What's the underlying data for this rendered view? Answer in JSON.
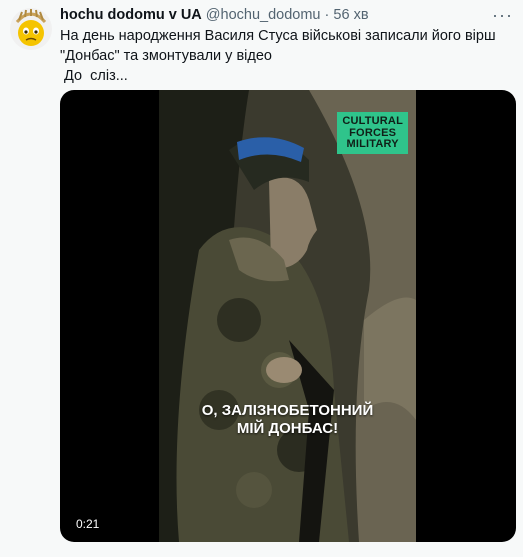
{
  "tweet": {
    "author_name": "hochu dodomu v UA",
    "handle": "@hochu_dodomu",
    "separator": "·",
    "time": "56 хв",
    "more": "···",
    "text_lines": [
      "На день народження Василя Стуса військові записали його вірш",
      "\"Донбас\" та змонтували у відео",
      " До  сліз..."
    ]
  },
  "media": {
    "badge_lines": [
      "CULTURAL",
      "FORCES",
      "MILITARY"
    ],
    "subtitle_lines": [
      "О, ЗАЛІЗНОБЕТОННИЙ",
      "МІЙ ДОНБАС!"
    ],
    "duration": "0:21"
  },
  "colors": {
    "badge": "#2fc48b",
    "page_background": "#f7f9f9",
    "secondary_text": "#536471"
  }
}
